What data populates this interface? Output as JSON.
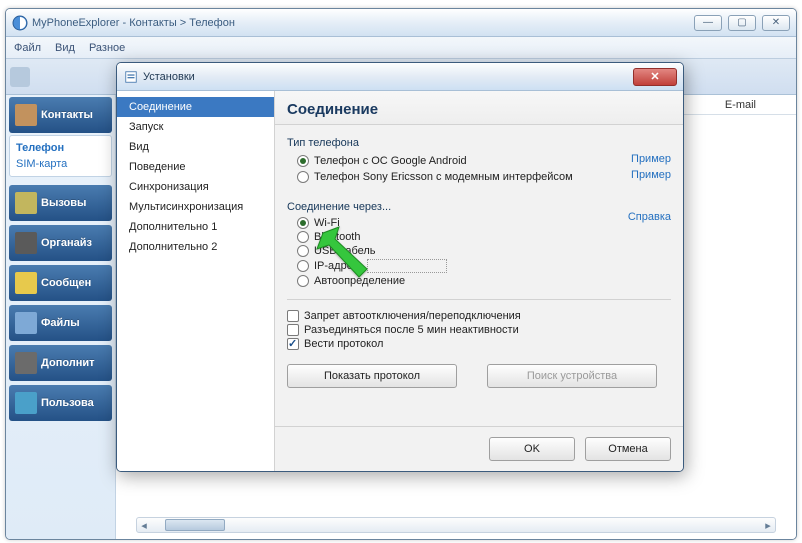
{
  "app": {
    "title": "MyPhoneExplorer  -  Контакты > Телефон"
  },
  "menubar": {
    "file": "Файл",
    "view": "Вид",
    "misc": "Разное"
  },
  "sidebar": {
    "items": [
      {
        "label": "Контакты"
      },
      {
        "label": "Вызовы"
      },
      {
        "label": "Органайз"
      },
      {
        "label": "Сообщен"
      },
      {
        "label": "Файлы"
      },
      {
        "label": "Дополнит"
      },
      {
        "label": "Пользова"
      }
    ],
    "sub": {
      "phone": "Телефон",
      "sim": "SIM-карта"
    }
  },
  "columns": {
    "email": "E-mail"
  },
  "dialog": {
    "title": "Установки",
    "nav": [
      "Соединение",
      "Запуск",
      "Вид",
      "Поведение",
      "Синхронизация",
      "Мультисинхронизация",
      "Дополнительно 1",
      "Дополнительно 2"
    ],
    "section_title": "Соединение",
    "phone_type": {
      "label": "Тип телефона",
      "android": "Телефон с ОС Google Android",
      "sony": "Телефон Sony Ericsson с модемным интерфейсом",
      "example": "Пример"
    },
    "connect_via": {
      "label": "Соединение через...",
      "help": "Справка",
      "wifi": "Wi-Fi",
      "bt": "Bluetooth",
      "usb": "USB-кабель",
      "ip": "IP-адрес",
      "auto": "Автоопределение"
    },
    "checks": {
      "block_reconn": "Запрет автоотключения/переподключения",
      "disconnect5": "Разъединяться после 5 мин неактивности",
      "log": "Вести протокол"
    },
    "buttons": {
      "show_log": "Показать протокол",
      "search_dev": "Поиск устройства",
      "ok": "OK",
      "cancel": "Отмена"
    }
  }
}
